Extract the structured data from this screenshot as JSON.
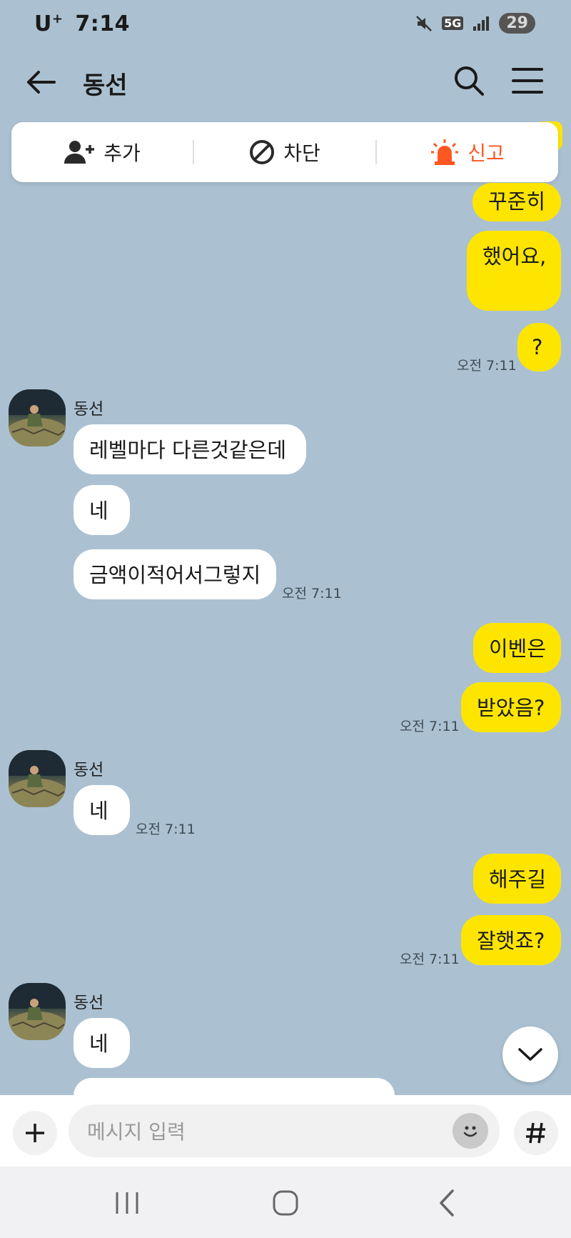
{
  "status_bar": {
    "carrier": "U",
    "carrier_sup": "+",
    "time": "7:14",
    "network": "5G",
    "battery": "29"
  },
  "header": {
    "title": "동선"
  },
  "action_bar": {
    "add": "추가",
    "block": "차단",
    "report": "신고"
  },
  "messages": {
    "m1": "꾸준히",
    "m2": "했어요,",
    "m3": "?",
    "t1": "오전 7:11",
    "s1": "동선",
    "m4": "레벨마다 다른것같은데",
    "m5": "네",
    "m6": "금액이적어서그렇지",
    "t2": "오전 7:11",
    "m7": "이벤은",
    "m8": "받았음?",
    "t3": "오전 7:11",
    "s2": "동선",
    "m9": "네",
    "t4": "오전 7:11",
    "m10": "해주길",
    "m11": "잘햇죠?",
    "t5": "오전 7:11",
    "s3": "동선",
    "m12": "네"
  },
  "input": {
    "placeholder": "메시지 입력"
  },
  "colors": {
    "background": "#abc1d1",
    "my_bubble": "#fee500",
    "their_bubble": "#ffffff",
    "report": "#ff5722"
  }
}
